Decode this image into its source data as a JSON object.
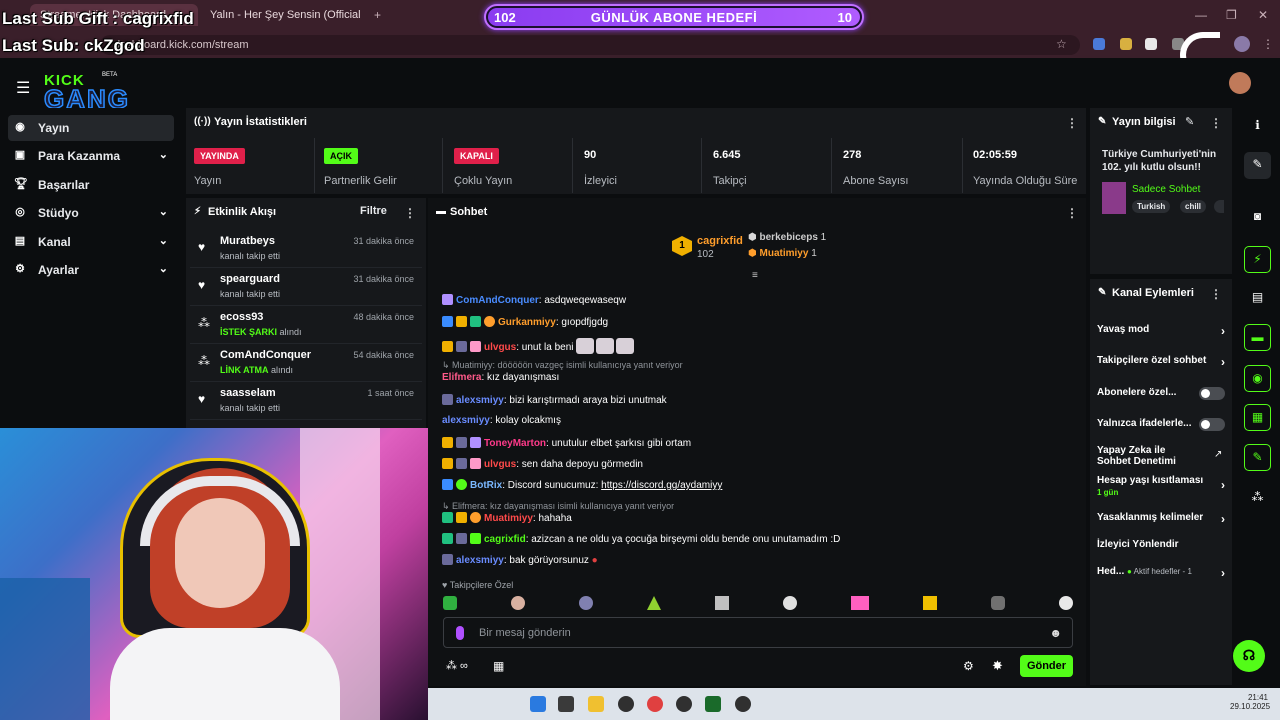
{
  "browser": {
    "tabs": [
      {
        "label": "Streamer Kick Dashboard"
      },
      {
        "label": "Yalın - Her Şey Sensin (Official"
      }
    ],
    "url": "dashboard.kick.com/stream"
  },
  "overlay": {
    "last_sub_gift": "Last Sub Gift : cagrixfid",
    "last_sub": "Last Sub: ckZgod",
    "goal_current": "102",
    "goal_title": "GÜNLÜK ABONE HEDEFİ",
    "goal_target": "10",
    "goal_progress": 1.0
  },
  "logo": {
    "text": "KICK",
    "sub": "GANG",
    "badge": "BETA"
  },
  "sidebar": {
    "items": [
      {
        "label": "Yayın",
        "icon": "broadcast-icon"
      },
      {
        "label": "Para Kazanma",
        "icon": "dollar-icon"
      },
      {
        "label": "Başarılar",
        "icon": "trophy-icon"
      },
      {
        "label": "Stüdyo",
        "icon": "studio-icon"
      },
      {
        "label": "Kanal",
        "icon": "channel-icon"
      },
      {
        "label": "Ayarlar",
        "icon": "gear-icon"
      }
    ]
  },
  "stats": {
    "title": "Yayın İstatistikleri",
    "items": [
      {
        "badge": "YAYINDA",
        "label": "Yayın"
      },
      {
        "badge": "AÇIK",
        "label": "Partnerlik Gelir"
      },
      {
        "badge": "KAPALI",
        "label": "Çoklu Yayın"
      },
      {
        "value": "90",
        "label": "İzleyici"
      },
      {
        "value": "6.645",
        "label": "Takipçi"
      },
      {
        "value": "278",
        "label": "Abone Sayısı"
      },
      {
        "value": "02:05:59",
        "label": "Yayında Olduğu Süre"
      }
    ]
  },
  "activity": {
    "title": "Etkinlik Akışı",
    "filter": "Filtre",
    "items": [
      {
        "name": "Muratbeys",
        "sub": "kanalı takip etti",
        "time": "31 dakika önce"
      },
      {
        "name": "spearguard",
        "sub": "kanalı takip etti",
        "time": "31 dakika önce"
      },
      {
        "name": "ecoss93",
        "tag": "İSTEK ŞARKI",
        "sub": "alındı",
        "time": "48 dakika önce"
      },
      {
        "name": "ComAndConquer",
        "tag": "LİNK ATMA",
        "sub": "alındı",
        "time": "54 dakika önce"
      },
      {
        "name": "saasselam",
        "sub": "kanalı takip etti",
        "time": "1 saat önce"
      }
    ]
  },
  "chat": {
    "title": "Sohbet",
    "top_gifter": {
      "name": "cagrixfid",
      "count": "102"
    },
    "gifters": [
      {
        "name": "berkebiceps",
        "count": "1"
      },
      {
        "name": "Muatimiyy",
        "count": "1"
      }
    ],
    "messages": [
      {
        "user": "ComAndConquer",
        "color": "#4a8cff",
        "text": ": asdqweqewaseqw"
      },
      {
        "user": "Gurkanmiyy",
        "color": "#ff9e2c",
        "text": ": gıopdfjgdg"
      },
      {
        "user": "ulvgus",
        "color": "#ff4a4a",
        "text": ": unut la beni"
      },
      {
        "reply": "Muatimiyy: dööööön vazgeç isimli kullanıcıya yanıt veriyor"
      },
      {
        "user": "Elifmera",
        "color": "#ff5a8a",
        "text": ": kız dayanışması"
      },
      {
        "user": "alexsmiyy",
        "color": "#6a8cff",
        "text": ": bizi karıştırmadı araya bizi unutmak"
      },
      {
        "user": "alexsmiyy",
        "color": "#6a8cff",
        "text": ": kolay olcakmış"
      },
      {
        "user": "ToneyMarton",
        "color": "#ff3a8a",
        "text": ": unutulur elbet şarkısı gibi ortam"
      },
      {
        "user": "ulvgus",
        "color": "#ff4a4a",
        "text": ": sen daha depoyu görmedin"
      },
      {
        "user": "BotRix",
        "color": "#7ab8ff",
        "text": ": Discord sunucumuz: ",
        "link": "https://discord.gg/aydamiyy"
      },
      {
        "reply": "Elifmera: kız dayanışması isimli kullanıcıya yanıt veriyor"
      },
      {
        "user": "Muatimiyy",
        "color": "#ff4a4a",
        "text": ": hahaha"
      },
      {
        "user": "cagrixfid",
        "color": "#53fc18",
        "text": ": azizcan a ne oldu ya çocuğa birşeymi oldu bende onu unutamadım :D"
      },
      {
        "user": "alexsmiyy",
        "color": "#6a8cff",
        "text": ": bak görüyorsunuz"
      }
    ],
    "followers_only": "Takipçilere Özel",
    "placeholder": "Bir mesaj gönderin",
    "send": "Gönder"
  },
  "stream_info": {
    "title": "Yayın bilgisi",
    "stream_title": "Türkiye Cumhuriyeti'nin 102. yılı kutlu olsun!!",
    "category": "Sadece Sohbet",
    "tags": [
      "Turkish",
      "chill"
    ]
  },
  "channel_actions": {
    "title": "Kanal Eylemleri",
    "items": [
      {
        "label": "Yavaş mod"
      },
      {
        "label": "Takipçilere özel sohbet"
      },
      {
        "label": "Abonelere özel..."
      },
      {
        "label": "Yalnızca ifadelerle..."
      },
      {
        "label": "Yapay Zeka ile Sohbet Denetimi"
      },
      {
        "label": "Hesap yaşı kısıtlaması",
        "sub": "1 gün"
      },
      {
        "label": "Yasaklanmış kelimeler"
      },
      {
        "label": "İzleyici Yönlendir"
      },
      {
        "label": "Hed...",
        "sub": "Aktif hedefler - 1"
      }
    ]
  },
  "taskbar": {
    "time": "21:41",
    "date": "29.10.2025"
  },
  "colors": {
    "kick_green": "#53fc18",
    "live_red": "#e0204a",
    "panel": "#16181b"
  }
}
